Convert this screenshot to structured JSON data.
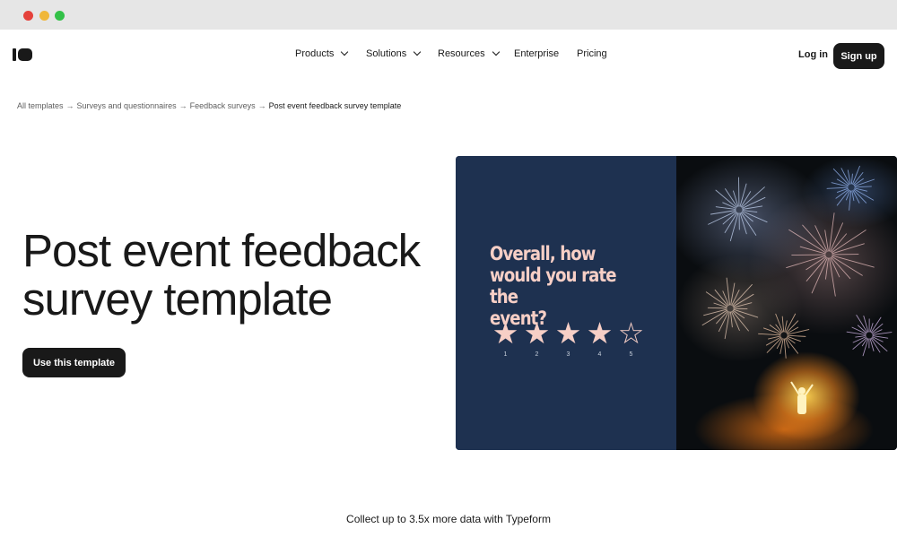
{
  "nav": {
    "menu": [
      {
        "label": "Products",
        "dropdown": true
      },
      {
        "label": "Solutions",
        "dropdown": true
      },
      {
        "label": "Resources",
        "dropdown": true
      },
      {
        "label": "Enterprise",
        "dropdown": false
      },
      {
        "label": "Pricing",
        "dropdown": false
      }
    ],
    "login": "Log in",
    "signup": "Sign up"
  },
  "breadcrumb": {
    "items": [
      "All templates",
      "Surveys and questionnaires",
      "Feedback surveys"
    ],
    "current": "Post event feedback survey template",
    "separator": "→"
  },
  "hero": {
    "title_line1": "Post event feedback",
    "title_line2": "survey template",
    "cta": "Use this template"
  },
  "preview": {
    "question_line1": "Overall, how",
    "question_line2": "would you rate the",
    "question_line3": "event?",
    "rating": {
      "value": 4,
      "max": 5,
      "labels": [
        "1",
        "2",
        "3",
        "4",
        "5"
      ]
    },
    "colors": {
      "panel": "#1e3150",
      "accent": "#f7cfc6"
    }
  },
  "tagline": "Collect up to 3.5x more data with Typeform"
}
